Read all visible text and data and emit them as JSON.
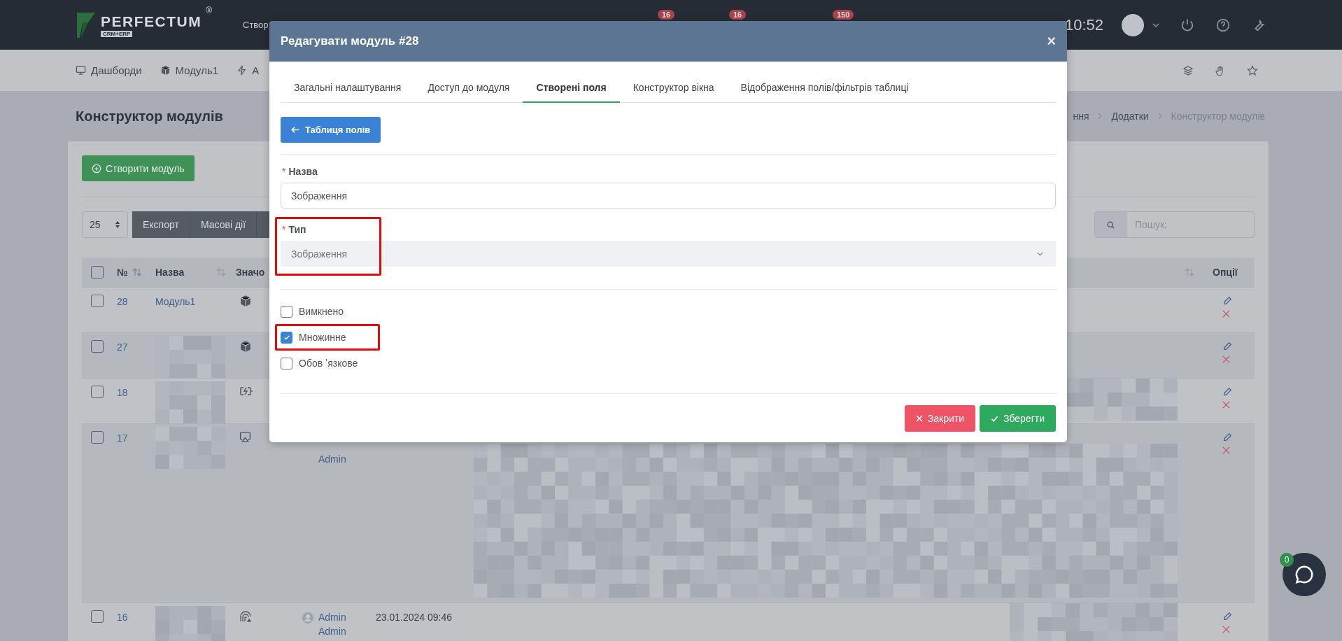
{
  "topbar": {
    "logo": "PERFECTUM",
    "logo_mark": "®",
    "logo_tagline": "CRM+ERP",
    "menu_item": "Створ",
    "badges": [
      "16",
      "16",
      "150"
    ],
    "time": "10:52"
  },
  "navbar": {
    "items": [
      {
        "label": "Дашборди"
      },
      {
        "label": "Модуль1"
      },
      {
        "label": "А"
      }
    ]
  },
  "page": {
    "title": "Конструктор модулів",
    "breadcrumbs": [
      {
        "label": "ння",
        "current": false
      },
      {
        "label": "Додатки",
        "current": false
      },
      {
        "label": "Конструктор модулів",
        "current": true
      }
    ]
  },
  "card": {
    "create_button": "Створити модуль",
    "page_size": "25",
    "toolbar": [
      "Експорт",
      "Масові дії"
    ],
    "search": {
      "placeholder": "Пошук:"
    },
    "table": {
      "columns": [
        "№",
        "Назва",
        "Значо",
        "Опції"
      ],
      "select_all_checked": false,
      "rows": [
        {
          "checked": false,
          "number": "28",
          "name": "Модуль1",
          "authors": [],
          "date": ""
        },
        {
          "checked": false,
          "number": "27",
          "authors": [],
          "date": ""
        },
        {
          "checked": false,
          "number": "18",
          "authors": [],
          "date": ""
        },
        {
          "checked": false,
          "number": "17",
          "authors": [
            "Admin"
          ],
          "date": ""
        },
        {
          "checked": false,
          "number": "16",
          "authors": [
            "Admin",
            "Admin"
          ],
          "date": "23.01.2024 09:46"
        }
      ]
    }
  },
  "modal": {
    "title": "Редагувати модуль #28",
    "close": "×",
    "tabs": [
      {
        "label": "Загальні налаштування",
        "selected": false
      },
      {
        "label": "Доступ до модуля",
        "selected": false
      },
      {
        "label": "Створені поля",
        "selected": true
      },
      {
        "label": "Конструктор вікна",
        "selected": false
      },
      {
        "label": "Відображення полів/фільтрів таблиці",
        "selected": false
      }
    ],
    "back_button": "Таблиця полів",
    "fields": [
      {
        "label": "Назва",
        "required_mark": "*",
        "kind": "input",
        "value": "Зображення",
        "highlighted": false
      },
      {
        "label": "Тип",
        "required_mark": "*",
        "kind": "select",
        "value": "Зображення",
        "highlighted": true
      }
    ],
    "checkboxes": [
      {
        "label": "Вимкнено",
        "checked": false,
        "highlighted": false
      },
      {
        "label": "Множинне",
        "checked": true,
        "highlighted": true
      },
      {
        "label": "Обов ʼязкове",
        "checked": false,
        "highlighted": false
      }
    ],
    "buttons": [
      {
        "label": "Закрити",
        "kind": "cancel"
      },
      {
        "label": "Зберегти",
        "kind": "save"
      }
    ]
  },
  "chat": {
    "badge": "0"
  }
}
